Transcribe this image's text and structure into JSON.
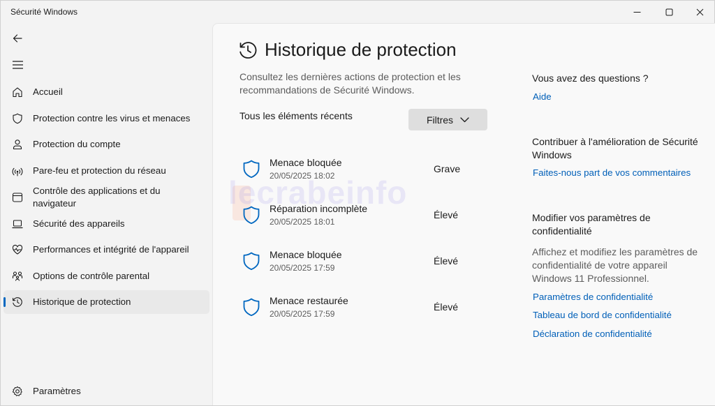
{
  "window": {
    "title": "Sécurité Windows"
  },
  "sidebar": {
    "items": [
      {
        "label": "Accueil",
        "icon": "home-icon"
      },
      {
        "label": "Protection contre les virus et menaces",
        "icon": "shield-icon"
      },
      {
        "label": "Protection du compte",
        "icon": "person-icon"
      },
      {
        "label": "Pare-feu et protection du réseau",
        "icon": "wifi-icon"
      },
      {
        "label": "Contrôle des applications et du navigateur",
        "icon": "app-browser-icon"
      },
      {
        "label": "Sécurité des appareils",
        "icon": "laptop-icon"
      },
      {
        "label": "Performances et intégrité de l'appareil",
        "icon": "heart-pulse-icon"
      },
      {
        "label": "Options de contrôle parental",
        "icon": "family-icon"
      },
      {
        "label": "Historique de protection",
        "icon": "history-icon",
        "selected": true
      }
    ],
    "settings_label": "Paramètres"
  },
  "main": {
    "title": "Historique de protection",
    "description": "Consultez les dernières actions de protection et les recommandations de Sécurité Windows.",
    "recent_label": "Tous les éléments récents",
    "filter_label": "Filtres",
    "history": [
      {
        "title": "Menace bloquée",
        "date": "20/05/2025 18:02",
        "severity": "Grave"
      },
      {
        "title": "Réparation incomplète",
        "date": "20/05/2025 18:01",
        "severity": "Élevé"
      },
      {
        "title": "Menace bloquée",
        "date": "20/05/2025 17:59",
        "severity": "Élevé"
      },
      {
        "title": "Menace restaurée",
        "date": "20/05/2025 17:59",
        "severity": "Élevé"
      }
    ],
    "watermark": "lecrabeinfo"
  },
  "aside": {
    "questions_heading": "Vous avez des questions ?",
    "help_link": "Aide",
    "contribute_heading": "Contribuer à l'amélioration de Sécurité Windows",
    "feedback_link": "Faites-nous part de vos commentaires",
    "privacy_heading": "Modifier vos paramètres de confidentialité",
    "privacy_text": "Affichez et modifiez les paramètres de confidentialité de votre appareil Windows 11 Professionnel.",
    "privacy_links": [
      "Paramètres de confidentialité",
      "Tableau de bord de confidentialité",
      "Déclaration de confidentialité"
    ]
  },
  "colors": {
    "accent": "#0067c0",
    "link": "#005fb8",
    "shield": "#0067c0"
  }
}
